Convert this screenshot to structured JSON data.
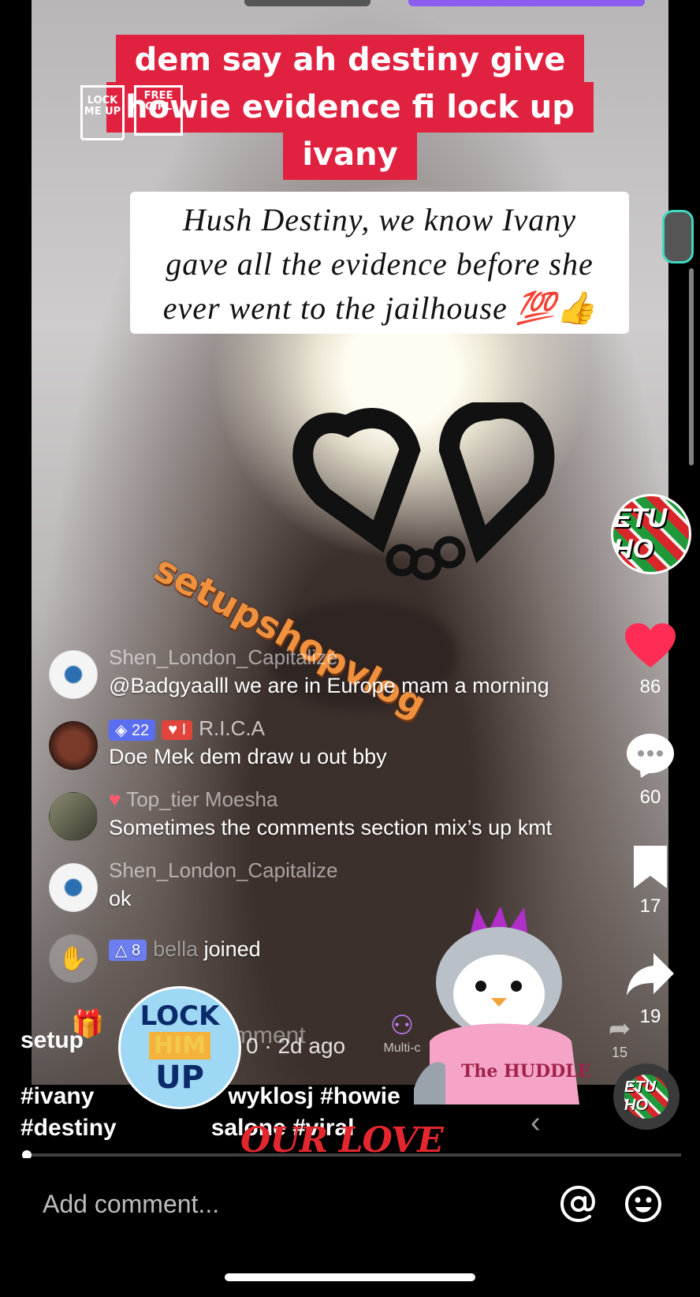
{
  "captions": {
    "red": [
      "dem say ah destiny give",
      "howie evidence fi lock up",
      "ivany"
    ],
    "white": [
      "Hush Destiny, we know Ivany",
      "gave all the evidence before she",
      "ever went to the jailhouse 💯👍"
    ]
  },
  "watermark": "setupshopvlog",
  "stickers": {
    "lock_me_up": "LOCK ME UP",
    "free_girl": "FREE GIRL",
    "lock_him_up": [
      "LOCK",
      "HIM",
      "UP"
    ],
    "our_love": "OUR LOVE",
    "huddle": "The HUDDLE"
  },
  "live_comments": [
    {
      "name": "Shen_London_Capitalize",
      "text": "@Badgyaalll we are in Europe mam a morning"
    },
    {
      "badges": [
        "22",
        "I"
      ],
      "name": "R.I.C.A",
      "text": "Doe Mek dem draw u out bby"
    },
    {
      "name": "Top_tier Moesha",
      "text": "Sometimes the comments section mix’s up kmt"
    },
    {
      "name": "Shen_London_Capitalize",
      "text": "ok"
    },
    {
      "badges": [
        "8"
      ],
      "name": "bella",
      "joined": "joined"
    }
  ],
  "actions": {
    "likes": "86",
    "comments": "60",
    "saves": "17",
    "shares": "19",
    "live_share": "15",
    "multi": "Multi-c",
    "comment_partial": "mment"
  },
  "profile_text": "ETU HO",
  "post": {
    "user": "setup",
    "time_suffix": "0 · 2d ago",
    "hashtags_line1": [
      "#ivany",
      "wyklosj #howie"
    ],
    "hashtags_line2": [
      "#destiny",
      "salone #viral"
    ]
  },
  "comment_bar": {
    "placeholder": "Add comment..."
  },
  "colors": {
    "caption_red": "#e0213f",
    "like_red": "#ff2d55",
    "watermark_orange": "#f0913e"
  }
}
